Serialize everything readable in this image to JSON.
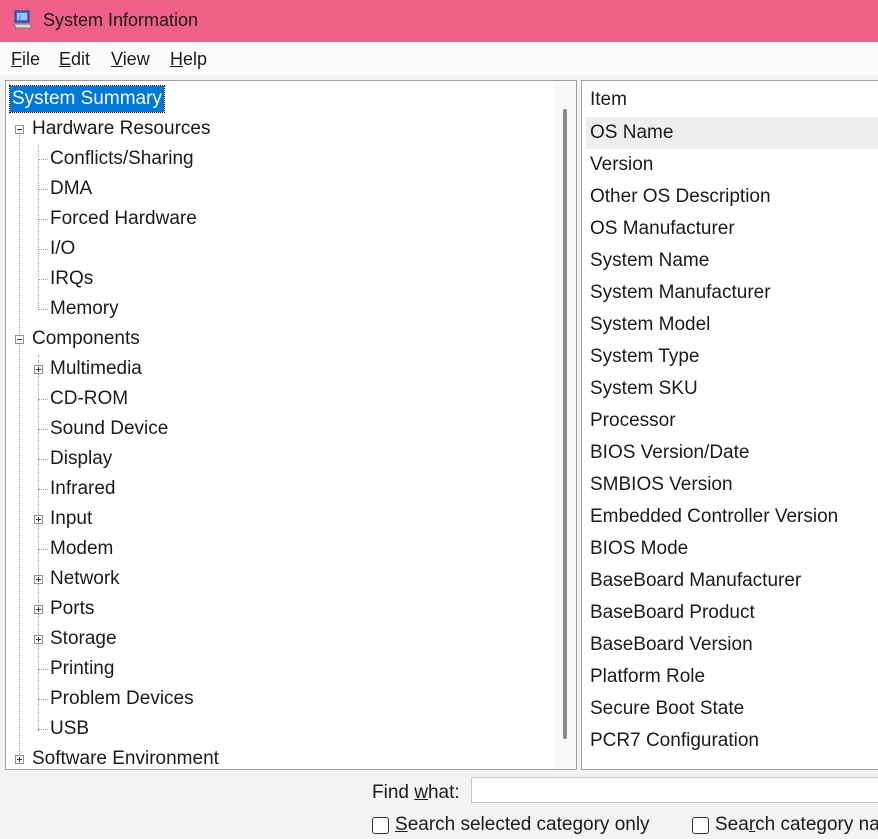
{
  "window": {
    "title": "System Information",
    "icon": "system-info-icon"
  },
  "menu": [
    {
      "label": "File",
      "key": "F",
      "rest": "ile"
    },
    {
      "label": "Edit",
      "key": "E",
      "rest": "dit"
    },
    {
      "label": "View",
      "key": "V",
      "rest": "iew"
    },
    {
      "label": "Help",
      "key": "H",
      "rest": "elp"
    }
  ],
  "tree": {
    "root": "System Summary",
    "hardware": {
      "label": "Hardware Resources",
      "children": [
        "Conflicts/Sharing",
        "DMA",
        "Forced Hardware",
        "I/O",
        "IRQs",
        "Memory"
      ]
    },
    "components": {
      "label": "Components",
      "children": [
        {
          "label": "Multimedia",
          "expandable": true
        },
        {
          "label": "CD-ROM",
          "expandable": false
        },
        {
          "label": "Sound Device",
          "expandable": false
        },
        {
          "label": "Display",
          "expandable": false
        },
        {
          "label": "Infrared",
          "expandable": false
        },
        {
          "label": "Input",
          "expandable": true
        },
        {
          "label": "Modem",
          "expandable": false
        },
        {
          "label": "Network",
          "expandable": true
        },
        {
          "label": "Ports",
          "expandable": true
        },
        {
          "label": "Storage",
          "expandable": true
        },
        {
          "label": "Printing",
          "expandable": false
        },
        {
          "label": "Problem Devices",
          "expandable": false
        },
        {
          "label": "USB",
          "expandable": false
        }
      ]
    },
    "software": {
      "label": "Software Environment"
    }
  },
  "list": {
    "header": "Item",
    "rows": [
      "OS Name",
      "Version",
      "Other OS Description",
      "OS Manufacturer",
      "System Name",
      "System Manufacturer",
      "System Model",
      "System Type",
      "System SKU",
      "Processor",
      "BIOS Version/Date",
      "SMBIOS Version",
      "Embedded Controller Version",
      "BIOS Mode",
      "BaseBoard Manufacturer",
      "BaseBoard Product",
      "BaseBoard Version",
      "Platform Role",
      "Secure Boot State",
      "PCR7 Configuration"
    ]
  },
  "find": {
    "label_pre": "Find ",
    "label_key": "w",
    "label_post": "hat:",
    "value": "",
    "option1": {
      "key": "S",
      "rest": "earch selected category only",
      "checked": false
    },
    "option2": {
      "pre": "Sea",
      "key": "r",
      "rest": "ch category na",
      "checked": false
    }
  },
  "colors": {
    "titlebar": "#ee6088",
    "selection": "#0078d7"
  }
}
